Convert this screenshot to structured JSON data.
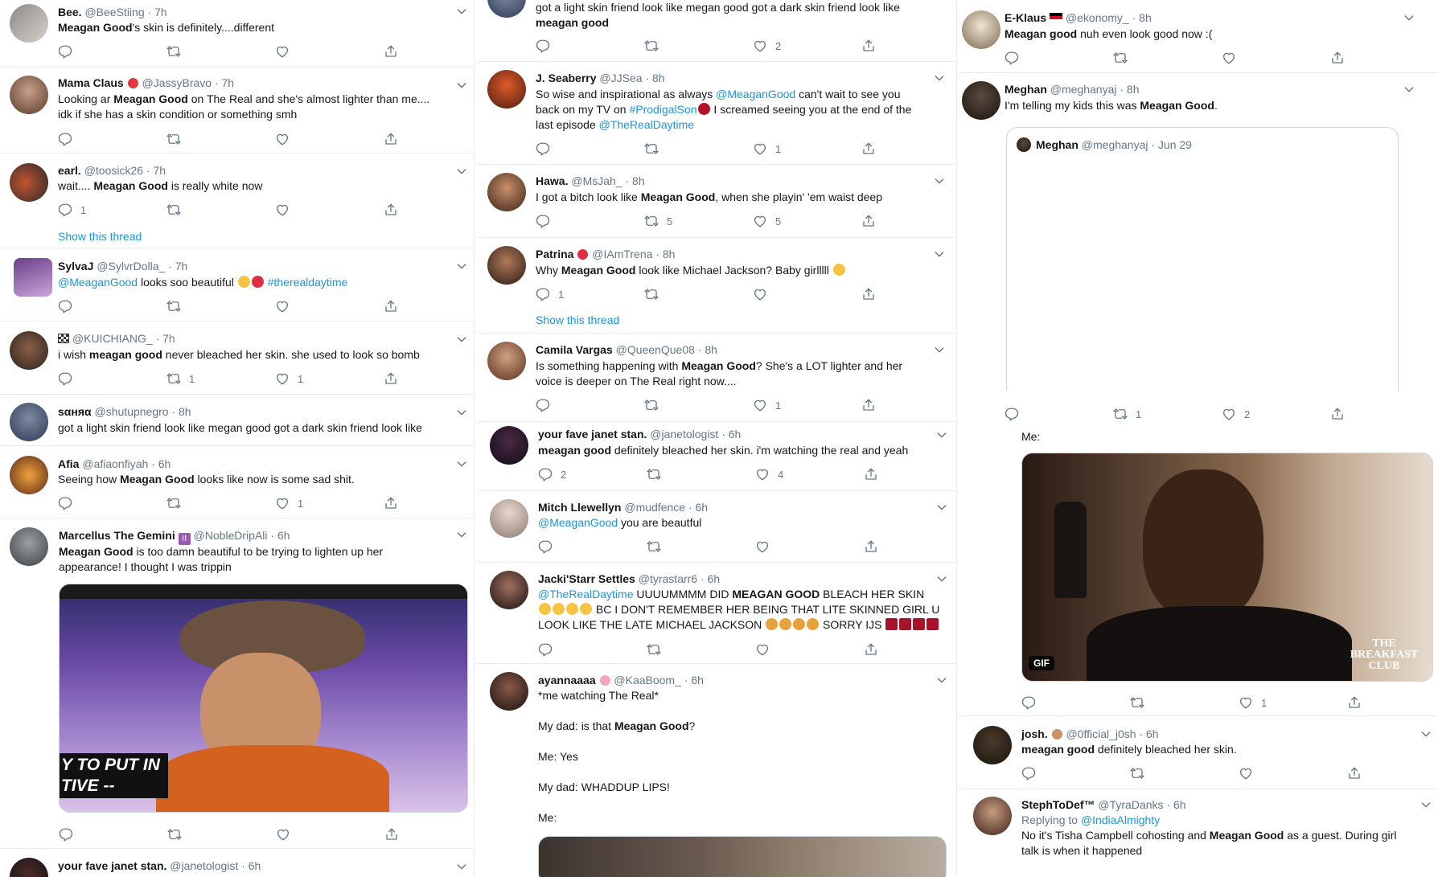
{
  "col1": {
    "t1": {
      "name": "Bee.",
      "handle": "@BeeStiing",
      "time": "· 7h",
      "bold": "Meagan Good",
      "rest": "'s skin is definitely....different",
      "likes": "",
      "replies": "",
      "retweets": ""
    },
    "t2": {
      "name": "Mama Claus",
      "handle": "@JassyBravo",
      "time": "· 7h",
      "pre": "Looking ar ",
      "bold": "Meagan Good",
      "rest": " on The Real and she's almost lighter than me....",
      "line2": "idk if she has a skin condition or something smh"
    },
    "t3": {
      "name": "earl.",
      "handle": "@toosick26",
      "time": "· 7h",
      "pre": "wait.... ",
      "bold": "Meagan Good",
      "rest": " is really white now",
      "replies": "1",
      "thread": "Show this thread"
    },
    "t4": {
      "name": "SylvaJ",
      "handle": "@SylvrDolla_",
      "time": "· 7h",
      "mention": "@MeaganGood",
      "rest": " looks soo beautiful ",
      "hashtag": "#therealdaytime"
    },
    "t5": {
      "name": "",
      "handle": "@KUICHIANG_",
      "time": "· 7h",
      "pre": "i wish ",
      "bold": "meagan good",
      "rest": " never bleached her skin. she used to look so bomb",
      "retweets": "1",
      "likes": "1"
    },
    "t6": {
      "name": "ѕαняα",
      "handle": "@shutupnegro",
      "time": "· 8h",
      "text": "got a light skin friend look like megan good got a dark skin friend look like"
    },
    "t7": {
      "name": "Afia",
      "handle": "@afiaonfiyah",
      "time": "· 6h",
      "pre": "Seeing how ",
      "bold": "Meagan Good",
      "rest": " looks like now is some sad shit.",
      "likes": "1"
    },
    "t8": {
      "name": "Marcellus The Gemini",
      "handle": "@NobleDripAli",
      "time": "· 6h",
      "bold": "Meagan Good",
      "rest": " is too damn beautiful to be trying to lighten up her",
      "line2": "appearance! I thought I was trippin",
      "caption1": "Y TO PUT IN",
      "caption2": "TIVE --"
    },
    "t9": {
      "name": "your fave janet stan.",
      "handle": "@janetologist",
      "time": "· 6h"
    }
  },
  "col2": {
    "t0": {
      "line1": "got a light skin friend look like megan good got a dark skin friend look like",
      "line2": "meagan good",
      "likes": "2"
    },
    "t1": {
      "name": "J. Seaberry",
      "handle": "@JJSea",
      "time": "· 8h",
      "pre": "So wise and inspirational as always ",
      "mention": "@MeaganGood",
      "rest": " can't wait to see you",
      "l2pre": "back on my TV on ",
      "hashtag": "#ProdigalSon",
      "l2rest": " I screamed seeing you at the end of the",
      "l3pre": "last episode ",
      "mention2": "@TheRealDaytime",
      "likes": "1"
    },
    "t2": {
      "name": "Hawa.",
      "handle": "@MsJah_",
      "time": "· 8h",
      "pre": "I got a bitch look like ",
      "bold": "Meagan Good",
      "rest": ", when she playin' 'em waist deep",
      "retweets": "5",
      "likes": "5"
    },
    "t3": {
      "name": "Patrina",
      "handle": "@IAmTrena",
      "time": "· 8h",
      "pre": "Why ",
      "bold": "Meagan Good",
      "rest": " look like Michael Jackson? Baby girlllll ",
      "replies": "1",
      "thread": "Show this thread"
    },
    "t4": {
      "name": "Camila Vargas",
      "handle": "@QueenQue08",
      "time": "· 8h",
      "pre": "Is something happening with ",
      "bold": "Meagan Good",
      "rest": "? She's a LOT lighter and her",
      "line2": "voice is deeper on The Real right now....",
      "likes": "1"
    },
    "t5": {
      "name": "your fave janet stan.",
      "handle": "@janetologist",
      "time": "· 6h",
      "bold": "meagan good",
      "rest": " definitely bleached her skin. i'm watching the real and yeah",
      "replies": "2",
      "likes": "4"
    },
    "t6": {
      "name": "Mitch Llewellyn",
      "handle": "@mudfence",
      "time": "· 6h",
      "mention": "@MeaganGood",
      "rest": " you are beautful"
    },
    "t7": {
      "name": "Jacki'Starr Settles",
      "handle": "@tyrastarr6",
      "time": "· 6h",
      "mention": "@TheRealDaytime",
      "rest": " UUUUMMMM DID ",
      "bold": "MEAGAN GOOD",
      "rest2": " BLEACH HER SKIN",
      "line2": " BC I DON'T REMEMBER HER BEING THAT LITE SKINNED GIRL U",
      "line3": "LOOK LIKE THE LATE MICHAEL JACKSON ",
      "line3b": " SORRY IJS "
    },
    "t8": {
      "name": "ayannaaaa",
      "handle": "@KaaBoom_",
      "time": "· 6h",
      "l1": "*me watching The Real*",
      "l2pre": "My dad: is that ",
      "bold": "Meagan Good",
      "l2rest": "?",
      "l3": "Me: Yes",
      "l4": "My dad: WHADDUP LIPS!",
      "l5": "Me:"
    }
  },
  "col3": {
    "t1": {
      "name": "E-Klaus",
      "handle": "@ekonomy_",
      "time": "· 8h",
      "bold": "Meagan good",
      "rest": " nuh even look good now :("
    },
    "t2": {
      "name": "Meghan",
      "handle": "@meghanyaj",
      "time": "· 8h",
      "pre": "I'm telling my kids this was ",
      "bold": "Meagan Good",
      "rest": ".",
      "qname": "Meghan",
      "qhandle": "@meghanyaj",
      "qtime": "· Jun 29",
      "retweets": "1",
      "likes": "2",
      "me": "Me:",
      "gif": "GIF",
      "watermark": "THE BREAKFAST CLUB",
      "likes2": "1"
    },
    "t3": {
      "name": "josh.",
      "handle": "@0fficial_j0sh",
      "time": "· 6h",
      "bold": "meagan good",
      "rest": " definitely bleached her skin."
    },
    "t4": {
      "name": "StephToDef™",
      "handle": "@TyraDanks",
      "time": "· 6h",
      "reply_pre": "Replying to ",
      "reply_to": "@IndiaAlmighty",
      "pre": "No it's Tisha Campbell cohosting and ",
      "bold": "Meagan Good",
      "rest": " as a guest. During girl",
      "line2": "talk is when it happened"
    }
  },
  "colors": {
    "link": "#1b95e0",
    "text": "#14171a",
    "muted": "#657786",
    "divider": "#e6ecf0"
  },
  "icons": [
    "reply-icon",
    "retweet-icon",
    "like-icon",
    "share-icon",
    "chevron-down-icon"
  ]
}
